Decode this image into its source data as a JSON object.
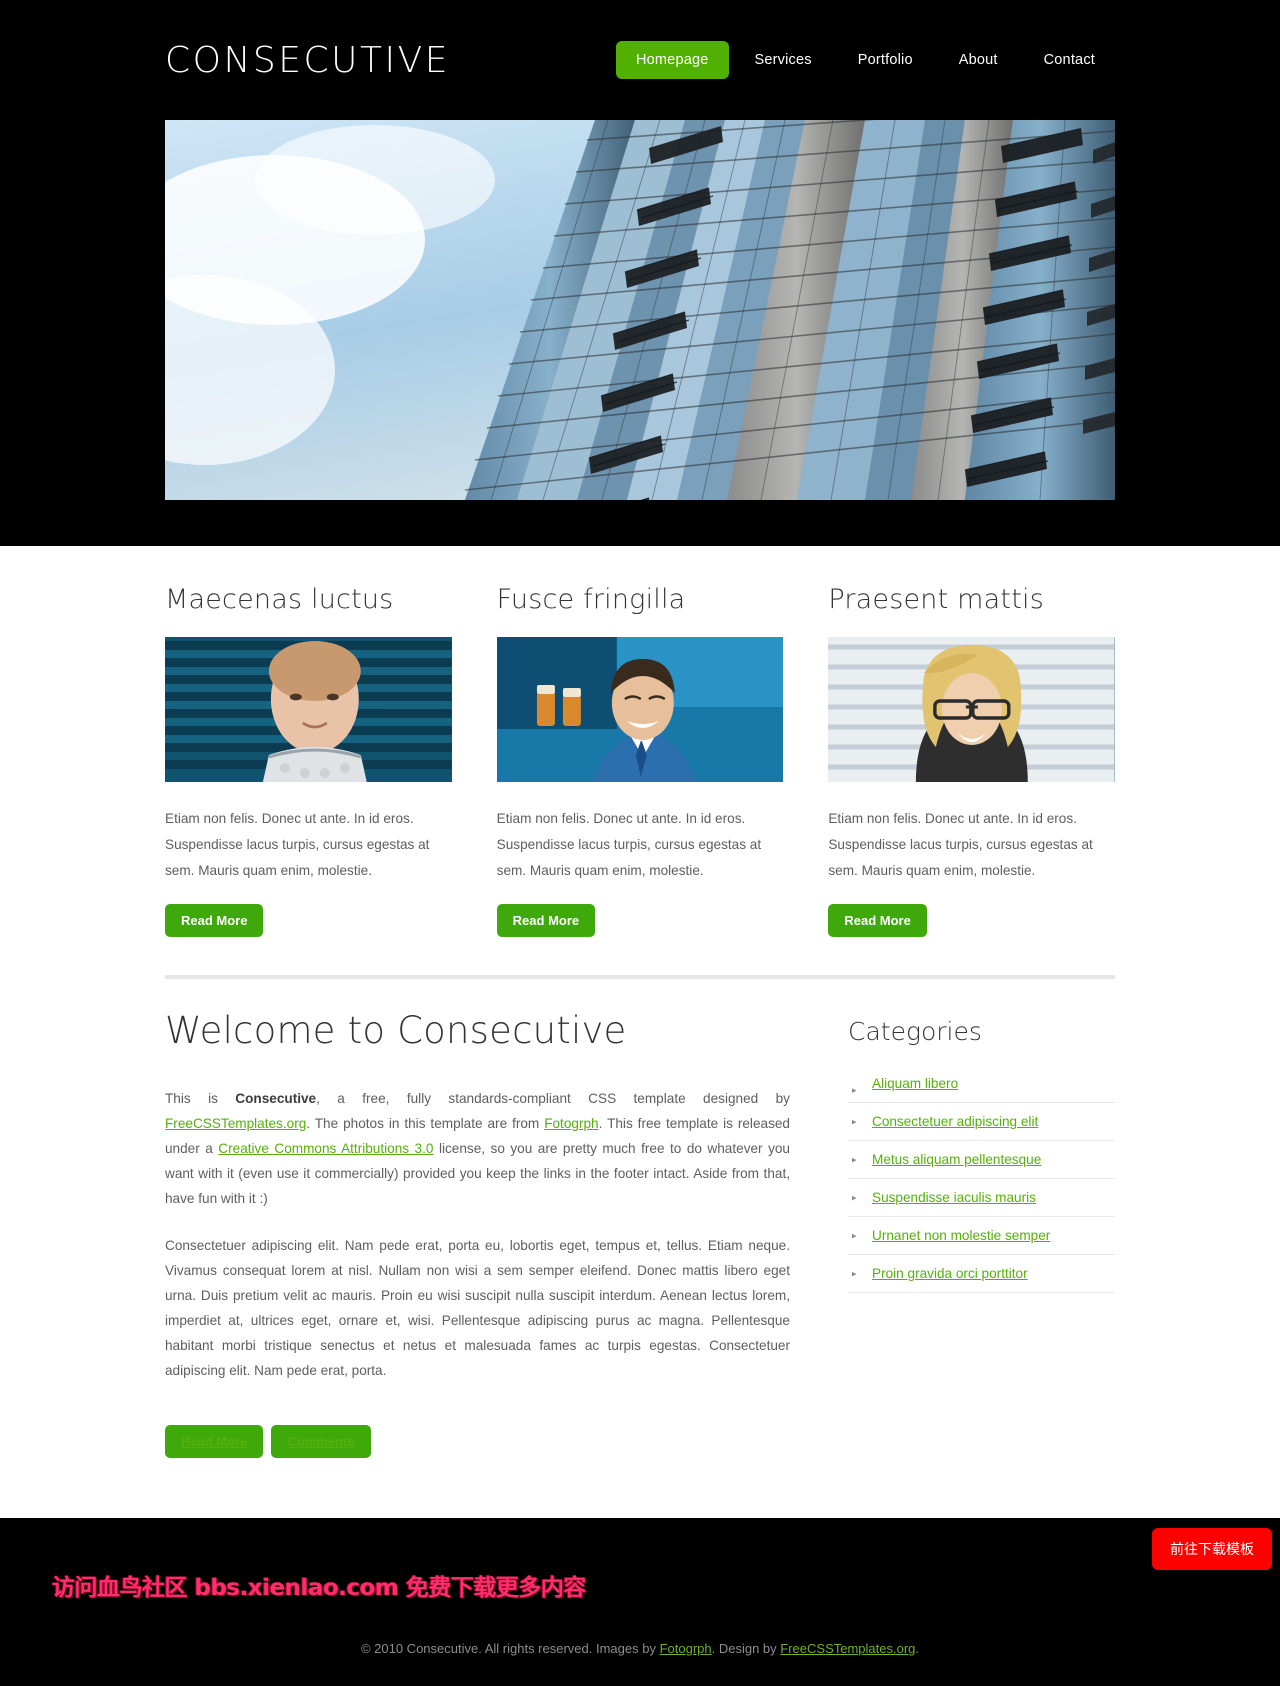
{
  "site": {
    "logo": "CONSECUTIVE"
  },
  "nav": {
    "items": [
      {
        "label": "Homepage",
        "active": true
      },
      {
        "label": "Services",
        "active": false
      },
      {
        "label": "Portfolio",
        "active": false
      },
      {
        "label": "About",
        "active": false
      },
      {
        "label": "Contact",
        "active": false
      }
    ]
  },
  "hero": {
    "alt": "High-rise glass office building photographed from below against a cloudy blue sky"
  },
  "boxes": [
    {
      "title": "Maecenas luctus",
      "image_alt": "Woman standing near window blinds",
      "text": "Etiam non felis. Donec ut ante. In id eros. Suspendisse lacus turpis, cursus egestas at sem. Mauris quam enim, molestie.",
      "button": "Read More"
    },
    {
      "title": "Fusce fringilla",
      "image_alt": "Smiling man in blue shirt and tie looking down",
      "text": "Etiam non felis. Donec ut ante. In id eros. Suspendisse lacus turpis, cursus egestas at sem. Mauris quam enim, molestie.",
      "button": "Read More"
    },
    {
      "title": "Praesent mattis",
      "image_alt": "Blonde woman with glasses smiling near window blinds",
      "text": "Etiam non felis. Donec ut ante. In id eros. Suspendisse lacus turpis, cursus egestas at sem. Mauris quam enim, molestie.",
      "button": "Read More"
    }
  ],
  "welcome": {
    "title": "Welcome to Consecutive",
    "para1": {
      "t1": "This is ",
      "strong": "Consecutive",
      "t2": ", a free, fully standards-compliant CSS template designed by ",
      "link1": "FreeCSSTemplates.org",
      "t3": ". The photos in this template are from ",
      "link2": "Fotogrph",
      "t4": ". This free template is released under a ",
      "link3": "Creative Commons Attributions 3.0",
      "t5": " license, so you are pretty much free to do whatever you want with it (even use it commercially) provided you keep the links in the footer intact. Aside from that, have fun with it :)"
    },
    "para2": "Consectetuer adipiscing elit. Nam pede erat, porta eu, lobortis eget, tempus et, tellus. Etiam neque. Vivamus consequat lorem at nisl. Nullam non wisi a sem semper eleifend. Donec mattis libero eget urna. Duis pretium velit ac mauris. Proin eu wisi suscipit nulla suscipit interdum. Aenean lectus lorem, imperdiet at, ultrices eget, ornare et, wisi. Pellentesque adipiscing purus ac magna. Pellentesque habitant morbi tristique senectus et netus et malesuada fames ac turpis egestas. Consectetuer adipiscing elit. Nam pede erat, porta.",
    "button_read_more": "Read More",
    "button_comments": "Comments"
  },
  "sidebar": {
    "title": "Categories",
    "bullet": "▸",
    "items": [
      "Aliquam libero",
      "Consectetuer adipiscing elit",
      "Metus aliquam pellentesque",
      "Suspendisse iaculis mauris",
      "Urnanet non molestie semper",
      "Proin gravida orci porttitor"
    ]
  },
  "footer": {
    "t1": "© 2010 Consecutive. All rights reserved. Images by ",
    "link1": "Fotogrph",
    "t2": ". Design by ",
    "link2": "FreeCSSTemplates.org",
    "t3": ".",
    "download_button": "前往下载模板",
    "watermark": "访问血鸟社区 bbs.xienlao.com 免费下载更多内容"
  },
  "colors": {
    "accent_green": "#52b003",
    "button_green": "#3fa80b",
    "link_green": "#56b00a",
    "header_black": "#000000",
    "download_red": "#ff0000"
  }
}
